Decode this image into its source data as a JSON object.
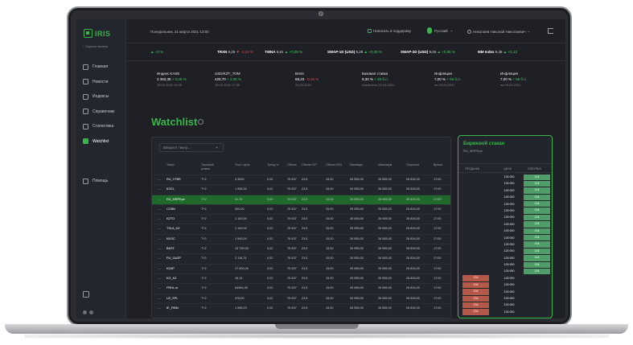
{
  "sidebar": {
    "logo": "IRIS",
    "hide_menu": "Скрыть панель",
    "items": [
      {
        "label": "Главная",
        "icon": "home-icon"
      },
      {
        "label": "Новости",
        "icon": "news-icon"
      },
      {
        "label": "Индексы",
        "icon": "chart-icon"
      },
      {
        "label": "Справочник",
        "icon": "folder-icon"
      },
      {
        "label": "Статистика",
        "icon": "stats-icon"
      },
      {
        "label": "Watchlist",
        "icon": "watchlist-icon"
      }
    ],
    "help": "Помощь"
  },
  "topbar": {
    "date": "Понедельник, 31 марта 2021 13:00",
    "support": "Написать в поддержку",
    "language": "Русский",
    "user": "Николаев Николай Николаевич"
  },
  "tickers": [
    {
      "name": "",
      "value": "",
      "change": "+3 %",
      "dir": "up"
    },
    {
      "name": "TRXN",
      "value": "9,25",
      "change": "-3,15 %",
      "dir": "down"
    },
    {
      "name": "TWNA",
      "value": "8,81",
      "change": "+0,05 %",
      "dir": "up"
    },
    {
      "name": "SWAP-1D (USD)",
      "value": "9,28",
      "change": "+0,49 %",
      "dir": "up"
    },
    {
      "name": "SWAP-2D (USD)",
      "value": "9,00",
      "change": "+0,96 %",
      "dir": "up"
    },
    {
      "name": "MM Index",
      "value": "9,36",
      "change": "+2,13",
      "dir": "up"
    }
  ],
  "indices": [
    {
      "title": "Индекс KASE",
      "value": "3 350,35",
      "change": "+ 0,05 %",
      "dir": "up",
      "date": "25.03.2021 16:00"
    },
    {
      "title": "USD/KZT_TOM",
      "value": "420,70",
      "change": "+ 2,05 %",
      "dir": "up",
      "date": "25.03.2021 17:00"
    },
    {
      "title": "Brent",
      "value": "68,23",
      "change": "- 0,15 %",
      "dir": "down",
      "date": "25.03.2021"
    },
    {
      "title": "Базовая ставка",
      "value": "9,30 %",
      "change": "+ 49 б.п.",
      "dir": "up",
      "date": "назначена 23.03.2021"
    },
    {
      "title": "Инфляция",
      "value": "7,00 %",
      "change": "+ 56 б.п.",
      "dir": "up",
      "date": "на 25.03.2021"
    },
    {
      "title": "Инфляция",
      "value": "7,00 %",
      "change": "+ 56 б.п.",
      "dir": "up",
      "date": "на 25.03.2021"
    }
  ],
  "watchlist": {
    "title": "Watchlist",
    "search_placeholder": "Введите тикер...",
    "columns": [
      "Тикер",
      "Торговый режим",
      "Посл. цена",
      "Тренд %",
      "Объем",
      "Объем KZT",
      "Объем USD",
      "Минимум",
      "Максимум",
      "Открытие",
      "Время"
    ],
    "rows": [
      {
        "ticker": "RU_VTBR",
        "mode": "T+2",
        "price": "3,3590",
        "pdir": "up",
        "trend": "0,02",
        "vol": "7К 637",
        "vkzt": "23,5",
        "vusd": "15,00",
        "min": "26 555,00",
        "max": "26 555,00",
        "open": "26 834,00",
        "time": "17:00"
      },
      {
        "ticker": "KCEL",
        "mode": "T+2",
        "price": "1 998,32",
        "pdir": "down",
        "trend": "0,02",
        "vol": "7К 637",
        "vkzt": "23,5",
        "vusd": "15,00",
        "min": "26 555,00",
        "max": "26 555,00",
        "open": "26 834,00",
        "time": "17:00"
      },
      {
        "ticker": "RU_MRPKpe",
        "mode": "T+2",
        "price": "11,73",
        "pdir": "up",
        "trend": "0,02",
        "vol": "7К 637",
        "vkzt": "23,5",
        "vusd": "15,00",
        "min": "26 555,00",
        "max": "26 555,00",
        "open": "26 834,00",
        "time": "17:00",
        "selected": true
      },
      {
        "ticker": "CCBN",
        "mode": "T+2",
        "price": "300,00",
        "pdir": "down",
        "trend": "0,02",
        "vol": "7К 637",
        "vkzt": "23,5",
        "vusd": "15,00",
        "min": "26 555,00",
        "max": "26 555,00",
        "open": "26 834,00",
        "time": "17:00"
      },
      {
        "ticker": "KZTO",
        "mode": "T+2",
        "price": "1 100,00",
        "pdir": "up",
        "trend": "0,02",
        "vol": "7К 637",
        "vkzt": "23,5",
        "vusd": "15,00",
        "min": "26 555,00",
        "max": "26 555,00",
        "open": "26 834,00",
        "time": "17:00"
      },
      {
        "ticker": "TSLA_KZ",
        "mode": "T+2",
        "price": "1 100,00",
        "pdir": "up",
        "trend": "0,02",
        "vol": "7К 637",
        "vkzt": "23,5",
        "vusd": "15,00",
        "min": "26 555,00",
        "max": "26 555,00",
        "open": "26 834,00",
        "time": "17:00"
      },
      {
        "ticker": "KEGC",
        "mode": "T+2",
        "price": "1 900,00",
        "pdir": "up",
        "trend": "0,02",
        "vol": "7К 637",
        "vkzt": "23,5",
        "vusd": "15,00",
        "min": "26 555,00",
        "max": "26 555,00",
        "open": "26 834,00",
        "time": "17:00"
      },
      {
        "ticker": "BAST",
        "mode": "T+2",
        "price": "13 790,00",
        "pdir": "down",
        "trend": "0,02",
        "vol": "7К 637",
        "vkzt": "23,5",
        "vusd": "15,00",
        "min": "26 555,00",
        "max": "26 555,00",
        "open": "26 834,00",
        "time": "17:00"
      },
      {
        "ticker": "RU_GAZP",
        "mode": "T+2",
        "price": "2 116,74",
        "pdir": "up",
        "trend": "0,02",
        "vol": "7К 637",
        "vkzt": "23,5",
        "vusd": "15,00",
        "min": "26 555,00",
        "max": "26 555,00",
        "open": "26 834,00",
        "time": "17:00"
      },
      {
        "ticker": "KZAP",
        "mode": "T+2",
        "price": "17 600,00",
        "pdir": "down",
        "trend": "0,02",
        "vol": "7К 637",
        "vkzt": "23,5",
        "vusd": "15,00",
        "min": "26 555,00",
        "max": "26 555,00",
        "open": "26 834,00",
        "time": "17:00"
      },
      {
        "ticker": "KO_KZ",
        "mode": "T+2",
        "price": "16,14",
        "pdir": "up",
        "trend": "0,02",
        "vol": "7К 637",
        "vkzt": "23,5",
        "vusd": "15,00",
        "min": "26 555,00",
        "max": "26 555,00",
        "open": "26 834,00",
        "time": "17:00"
      },
      {
        "ticker": "FRHL.or",
        "mode": "T+2",
        "price": "64984,35",
        "pdir": "down",
        "trend": "0,02",
        "vol": "7К 637",
        "vkzt": "23,5",
        "vusd": "15,00",
        "min": "26 555,00",
        "max": "26 555,00",
        "open": "26 834,00",
        "time": "17:00"
      },
      {
        "ticker": "UZ_SPL",
        "mode": "T+2",
        "price": "478,00",
        "pdir": "up",
        "trend": "0,02",
        "vol": "7К 637",
        "vkzt": "23,5",
        "vusd": "15,00",
        "min": "26 555,00",
        "max": "26 555,00",
        "open": "26 834,00",
        "time": "17:00"
      },
      {
        "ticker": "IE_FIBM",
        "mode": "T+2",
        "price": "1 596,23",
        "pdir": "down",
        "trend": "0,02",
        "vol": "7К 637",
        "vkzt": "23,5",
        "vusd": "15,00",
        "min": "26 555,00",
        "max": "26 555,00",
        "open": "26 834,00",
        "time": "17:00"
      }
    ]
  },
  "orderbook": {
    "title": "Биржевой стакан",
    "subtitle": "RU_MRPKpe",
    "columns": [
      "ПРОДАЖА",
      "ЦЕНА",
      "ПОКУПКА"
    ],
    "rows": [
      {
        "sell": "",
        "price": "128 900",
        "buy": "134"
      },
      {
        "sell": "",
        "price": "128 900",
        "buy": "134"
      },
      {
        "sell": "",
        "price": "128 900",
        "buy": "134"
      },
      {
        "sell": "",
        "price": "128 900",
        "buy": "134"
      },
      {
        "sell": "",
        "price": "128 900",
        "buy": "134"
      },
      {
        "sell": "",
        "price": "128 900",
        "buy": "134"
      },
      {
        "sell": "",
        "price": "128 900",
        "buy": "134"
      },
      {
        "sell": "",
        "price": "128 900",
        "buy": "134"
      },
      {
        "sell": "",
        "price": "128 900",
        "buy": "134"
      },
      {
        "sell": "",
        "price": "128 900",
        "buy": "134"
      },
      {
        "sell": "",
        "price": "128 900",
        "buy": "134"
      },
      {
        "sell": "",
        "price": "128 900",
        "buy": "134"
      },
      {
        "sell": "",
        "price": "128 900",
        "buy": "134"
      },
      {
        "sell": "",
        "price": "128 900",
        "buy": "134"
      },
      {
        "sell": "",
        "price": "128 900",
        "buy": "134"
      },
      {
        "sell": "134",
        "price": "128 900",
        "buy": ""
      },
      {
        "sell": "134",
        "price": "128 900",
        "buy": ""
      },
      {
        "sell": "134",
        "price": "128 900",
        "buy": ""
      },
      {
        "sell": "134",
        "price": "128 900",
        "buy": ""
      },
      {
        "sell": "134",
        "price": "128 900",
        "buy": ""
      },
      {
        "sell": "134",
        "price": "128 900",
        "buy": ""
      }
    ]
  }
}
